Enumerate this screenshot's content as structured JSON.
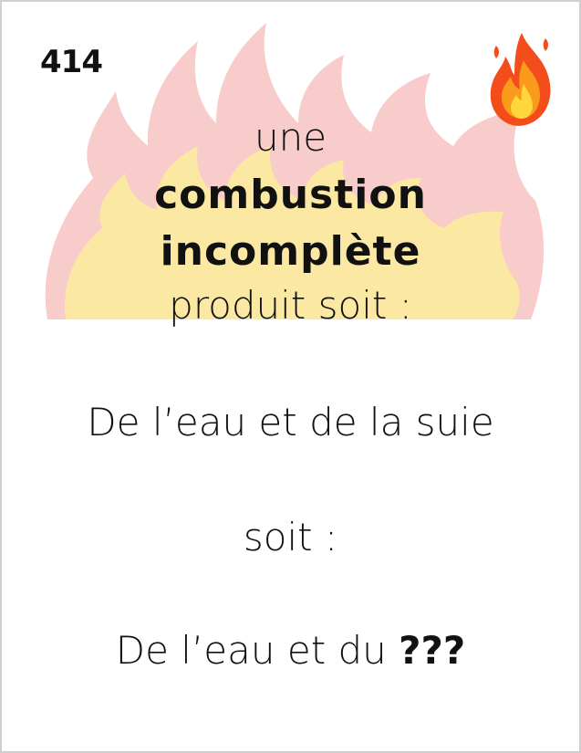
{
  "card": {
    "number": "414",
    "icon": "fire-icon",
    "background_art": "flames",
    "colors": {
      "flame_outer": "#f7c6c4",
      "flame_inner": "#fbeaa0",
      "icon_outer": "#f24d1a",
      "icon_mid": "#fb9b1c",
      "icon_inner": "#ffd73a"
    },
    "question": {
      "line1": "une",
      "line2": "combustion",
      "line3": "incomplète",
      "line4": "produit soit :"
    },
    "answer1": "De l’eau et de la suie",
    "separator": "soit :",
    "answer2_prefix": "De l’eau et du",
    "answer2_blank": "???"
  }
}
